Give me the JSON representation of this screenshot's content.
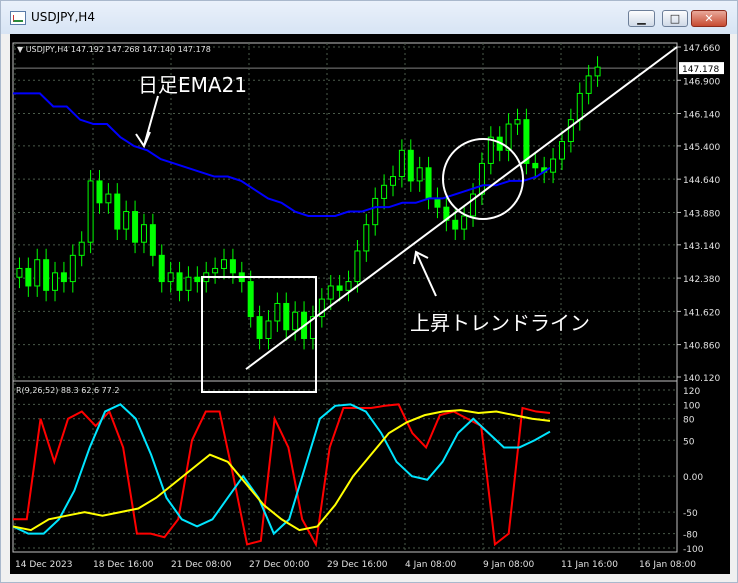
{
  "window": {
    "title": "USDJPY,H4",
    "min_icon": "minimize-icon",
    "max_icon": "maximize-icon",
    "close_icon": "close-icon",
    "min_glyph": "▁",
    "max_glyph": "□",
    "close_glyph": "✕"
  },
  "colors": {
    "background": "#000000",
    "candles": "#00ff00",
    "ema": "#0000ff",
    "trendline": "#ffffff",
    "red_line": "#ff0000",
    "cyan_line": "#00e5ff",
    "yellow_line": "#ffff00",
    "grid": "#4a5a4a",
    "price_box": "#ffffff"
  },
  "chart_data": {
    "type": "line",
    "symbol_header": "USDJPY,H4  147.192 147.268 147.140 147.178",
    "current_price_label": "147.178",
    "price_axis": {
      "ticks": [
        "147.660",
        "146.900",
        "146.140",
        "145.400",
        "144.640",
        "143.880",
        "143.140",
        "142.380",
        "141.620",
        "140.860",
        "140.120"
      ],
      "tick_values": [
        147.66,
        146.9,
        146.14,
        145.4,
        144.64,
        143.88,
        143.14,
        142.38,
        141.62,
        140.86,
        140.12
      ],
      "current_price": 147.178,
      "ylim": [
        140.12,
        147.66
      ]
    },
    "time_axis": [
      "14 Dec 2023",
      "18 Dec 16:00",
      "21 Dec 08:00",
      "27 Dec 00:00",
      "29 Dec 16:00",
      "4 Jan 08:00",
      "9 Jan 08:00",
      "11 Jan 16:00",
      "16 Jan 08:00"
    ],
    "series": [
      {
        "name": "USDJPY H4",
        "close_values": [
          142.6,
          142.2,
          142.8,
          142.1,
          142.5,
          142.3,
          142.9,
          143.2,
          144.6,
          144.1,
          144.3,
          143.5,
          143.9,
          143.2,
          143.6,
          142.9,
          142.3,
          142.5,
          142.1,
          142.4,
          142.3,
          142.5,
          142.6,
          142.8,
          142.5,
          142.3,
          141.5,
          141.0,
          141.4,
          141.8,
          141.2,
          141.6,
          141.0,
          141.5,
          141.9,
          142.2,
          142.1,
          142.3,
          143.0,
          143.6,
          144.2,
          144.5,
          144.7,
          145.3,
          144.6,
          144.9,
          144.2,
          144.0,
          143.7,
          143.5,
          143.8,
          144.3,
          145.0,
          145.6,
          145.3,
          145.9,
          146.0,
          145.0,
          144.9,
          144.8,
          145.1,
          145.5,
          146.0,
          146.6,
          147.0,
          147.2
        ]
      },
      {
        "name": "日足EMA21",
        "values": [
          146.6,
          146.6,
          146.6,
          146.3,
          146.3,
          146.0,
          145.9,
          145.9,
          145.6,
          145.4,
          145.3,
          145.1,
          145.0,
          144.9,
          144.8,
          144.7,
          144.7,
          144.6,
          144.4,
          144.2,
          144.1,
          143.9,
          143.8,
          143.8,
          143.8,
          143.9,
          143.9,
          144.0,
          144.0,
          144.1,
          144.1,
          144.2,
          144.2,
          144.3,
          144.4,
          144.5,
          144.5,
          144.6,
          144.6,
          144.7,
          144.9
        ]
      },
      {
        "name": "上昇トレンドライン",
        "values": [
          140.3,
          147.66
        ]
      }
    ],
    "annotations": {
      "ema_label": "日足EMA21",
      "trend_label": "上昇トレンドライン"
    },
    "oscillator": {
      "header": "R(9,26,52) 88.3 62.6 77.2",
      "ticks": [
        "120",
        "100",
        "80",
        "50",
        "0.00",
        "-50",
        "-80",
        "-100"
      ],
      "tick_values": [
        120,
        100,
        80,
        50,
        0,
        -50,
        -80,
        -100
      ],
      "ylim": [
        -100,
        120
      ],
      "series": [
        {
          "name": "red",
          "values": [
            -60,
            -60,
            80,
            20,
            80,
            90,
            70,
            90,
            40,
            -80,
            -80,
            -85,
            -60,
            50,
            90,
            90,
            0,
            -95,
            -90,
            80,
            40,
            -60,
            -95,
            40,
            95,
            95,
            95,
            98,
            100,
            60,
            40,
            85,
            90,
            80,
            70,
            -95,
            -80,
            95,
            90,
            88
          ]
        },
        {
          "name": "cyan",
          "values": [
            -70,
            -80,
            -80,
            -60,
            -20,
            40,
            90,
            100,
            80,
            30,
            -30,
            -60,
            -70,
            -60,
            -30,
            0,
            -30,
            -80,
            -60,
            10,
            80,
            98,
            100,
            90,
            60,
            20,
            0,
            -5,
            20,
            60,
            80,
            60,
            40,
            40,
            50,
            62
          ]
        },
        {
          "name": "yellow",
          "values": [
            -70,
            -75,
            -60,
            -55,
            -50,
            -55,
            -50,
            -45,
            -30,
            -10,
            10,
            30,
            20,
            -10,
            -40,
            -60,
            -75,
            -70,
            -40,
            0,
            30,
            60,
            75,
            85,
            90,
            92,
            88,
            90,
            85,
            80,
            77
          ]
        }
      ]
    }
  }
}
